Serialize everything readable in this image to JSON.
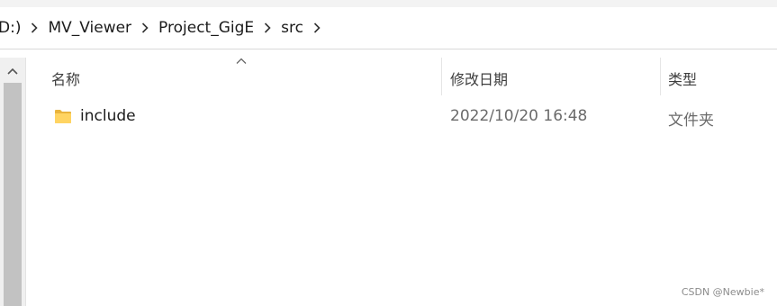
{
  "breadcrumb": {
    "items": [
      "D:)",
      "MV_Viewer",
      "Project_GigE",
      "src"
    ]
  },
  "columns": {
    "name": "名称",
    "date_modified": "修改日期",
    "type": "类型"
  },
  "files": [
    {
      "name": "include",
      "date_modified": "2022/10/20 16:48",
      "type": "文件夹",
      "icon": "folder-icon"
    }
  ],
  "watermark": "CSDN @Newbie*"
}
